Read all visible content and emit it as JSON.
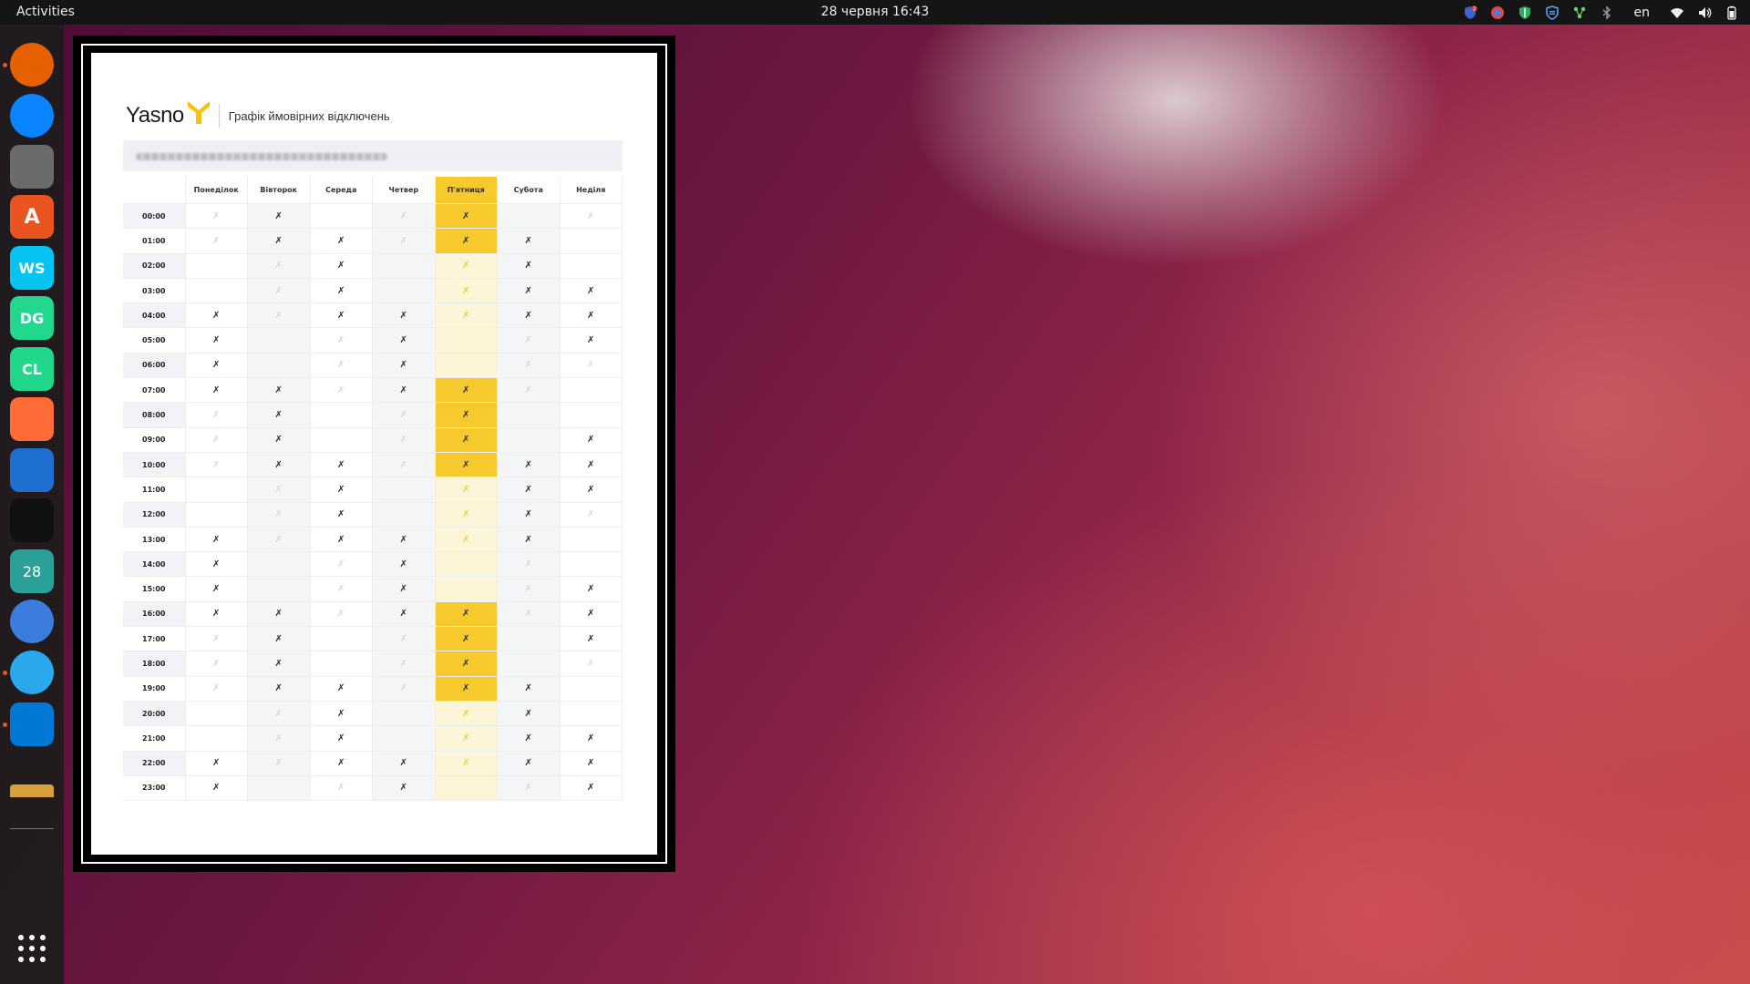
{
  "topbar": {
    "activities": "Activities",
    "clock": "28 червня  16:43",
    "language": "en",
    "tray_icons": [
      "shield-badge-icon",
      "vpn-icon",
      "guard-icon",
      "shield-icon",
      "network-share-icon",
      "bluetooth-icon",
      "wifi-icon",
      "volume-icon",
      "battery-icon"
    ],
    "tray_badge": "2"
  },
  "dock": {
    "items": [
      {
        "name": "firefox",
        "label": "",
        "color": "#e66000",
        "running": true
      },
      {
        "name": "thunderbird",
        "label": "",
        "color": "#0a84ff",
        "running": false
      },
      {
        "name": "files",
        "label": "",
        "color": "#6b6b6b",
        "running": false
      },
      {
        "name": "app-center",
        "label": "A",
        "color": "#e95420",
        "running": false
      },
      {
        "name": "webstorm",
        "label": "WS",
        "color": "#07c3f2",
        "running": false
      },
      {
        "name": "datagrip",
        "label": "DG",
        "color": "#22d88f",
        "running": false
      },
      {
        "name": "clion",
        "label": "CL",
        "color": "#21d789",
        "running": false
      },
      {
        "name": "postman",
        "label": "",
        "color": "#ff6c37",
        "running": false
      },
      {
        "name": "vpn-shield",
        "label": "",
        "color": "#1f6fd1",
        "running": false
      },
      {
        "name": "teams",
        "label": "",
        "color": "#111111",
        "running": false
      },
      {
        "name": "calendar",
        "label": "28",
        "color": "#2aa198",
        "running": false
      },
      {
        "name": "chromium",
        "label": "",
        "color": "#3b7ddd",
        "running": false
      },
      {
        "name": "telegram",
        "label": "",
        "color": "#29a9eb",
        "running": true
      },
      {
        "name": "vscode",
        "label": "",
        "color": "#0078d4",
        "running": true
      },
      {
        "name": "image-viewer",
        "label": "",
        "color": "#d9a13a",
        "running": false
      }
    ],
    "show_apps_label": "Show Applications"
  },
  "document": {
    "logo": "Yasno",
    "title": "Графік ймовірних відключень",
    "days": [
      "Понеділок",
      "Вівторок",
      "Середа",
      "Четвер",
      "П'ятниця",
      "Субота",
      "Неділя"
    ],
    "today_index": 4,
    "legend": {
      "D": "outage-icon-dark",
      "L": "outage-icon-light",
      "Y": "today-outage",
      "y": "today-possible",
      "-": "empty"
    },
    "icon_glyph_dark": "✗",
    "icon_glyph_light": "✗",
    "rows": [
      {
        "time": "00:00",
        "cells": [
          "L",
          "D",
          "-",
          "L",
          "Y",
          "-",
          "L"
        ]
      },
      {
        "time": "01:00",
        "cells": [
          "L",
          "D",
          "D",
          "L",
          "Y",
          "D",
          "-"
        ]
      },
      {
        "time": "02:00",
        "cells": [
          "-",
          "L",
          "D",
          "-",
          "y",
          "D",
          "-"
        ]
      },
      {
        "time": "03:00",
        "cells": [
          "-",
          "L",
          "D",
          "-",
          "y",
          "D",
          "D"
        ]
      },
      {
        "time": "04:00",
        "cells": [
          "D",
          "L",
          "D",
          "D",
          "y",
          "D",
          "D"
        ]
      },
      {
        "time": "05:00",
        "cells": [
          "D",
          "-",
          "L",
          "D",
          "l",
          "L",
          "D"
        ]
      },
      {
        "time": "06:00",
        "cells": [
          "D",
          "-",
          "L",
          "D",
          "l",
          "L",
          "L"
        ]
      },
      {
        "time": "07:00",
        "cells": [
          "D",
          "D",
          "L",
          "D",
          "Y",
          "L",
          "-"
        ]
      },
      {
        "time": "08:00",
        "cells": [
          "L",
          "D",
          "-",
          "L",
          "Y",
          "-",
          "-"
        ]
      },
      {
        "time": "09:00",
        "cells": [
          "L",
          "D",
          "-",
          "L",
          "Y",
          "-",
          "D"
        ]
      },
      {
        "time": "10:00",
        "cells": [
          "L",
          "D",
          "D",
          "L",
          "Y",
          "D",
          "D"
        ]
      },
      {
        "time": "11:00",
        "cells": [
          "-",
          "L",
          "D",
          "-",
          "y",
          "D",
          "D"
        ]
      },
      {
        "time": "12:00",
        "cells": [
          "-",
          "L",
          "D",
          "-",
          "y",
          "D",
          "L"
        ]
      },
      {
        "time": "13:00",
        "cells": [
          "D",
          "L",
          "D",
          "D",
          "y",
          "D",
          "-"
        ]
      },
      {
        "time": "14:00",
        "cells": [
          "D",
          "-",
          "L",
          "D",
          "l",
          "L",
          "-"
        ]
      },
      {
        "time": "15:00",
        "cells": [
          "D",
          "-",
          "L",
          "D",
          "l",
          "L",
          "D"
        ]
      },
      {
        "time": "16:00",
        "cells": [
          "D",
          "D",
          "L",
          "D",
          "Y",
          "L",
          "D"
        ]
      },
      {
        "time": "17:00",
        "cells": [
          "L",
          "D",
          "-",
          "L",
          "Y",
          "-",
          "D"
        ]
      },
      {
        "time": "18:00",
        "cells": [
          "L",
          "D",
          "-",
          "L",
          "Y",
          "-",
          "L"
        ]
      },
      {
        "time": "19:00",
        "cells": [
          "L",
          "D",
          "D",
          "L",
          "Y",
          "D",
          "-"
        ]
      },
      {
        "time": "20:00",
        "cells": [
          "-",
          "L",
          "D",
          "-",
          "y",
          "D",
          "-"
        ]
      },
      {
        "time": "21:00",
        "cells": [
          "-",
          "L",
          "D",
          "-",
          "y",
          "D",
          "D"
        ]
      },
      {
        "time": "22:00",
        "cells": [
          "D",
          "L",
          "D",
          "D",
          "y",
          "D",
          "D"
        ]
      },
      {
        "time": "23:00",
        "cells": [
          "D",
          "-",
          "L",
          "D",
          "l",
          "L",
          "D"
        ]
      }
    ]
  }
}
